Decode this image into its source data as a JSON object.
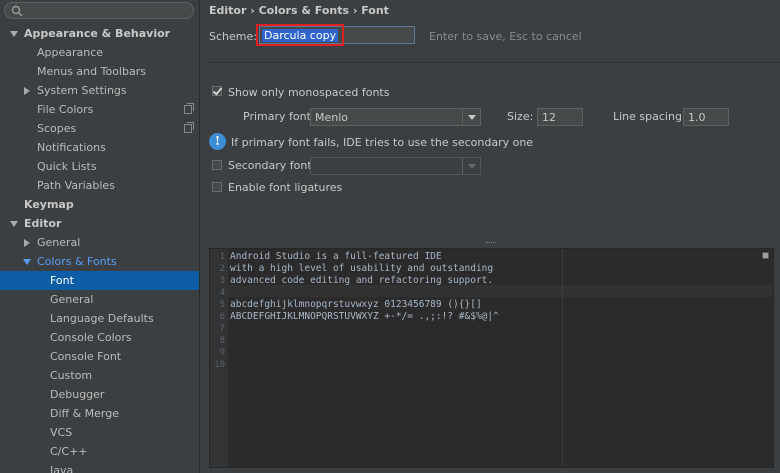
{
  "sidebar": {
    "search_placeholder": "",
    "items": [
      {
        "label": "Appearance & Behavior"
      },
      {
        "label": "Appearance"
      },
      {
        "label": "Menus and Toolbars"
      },
      {
        "label": "System Settings"
      },
      {
        "label": "File Colors"
      },
      {
        "label": "Scopes"
      },
      {
        "label": "Notifications"
      },
      {
        "label": "Quick Lists"
      },
      {
        "label": "Path Variables"
      },
      {
        "label": "Keymap"
      },
      {
        "label": "Editor"
      },
      {
        "label": "General"
      },
      {
        "label": "Colors & Fonts"
      },
      {
        "label": "Font"
      },
      {
        "label": "General"
      },
      {
        "label": "Language Defaults"
      },
      {
        "label": "Console Colors"
      },
      {
        "label": "Console Font"
      },
      {
        "label": "Custom"
      },
      {
        "label": "Debugger"
      },
      {
        "label": "Diff & Merge"
      },
      {
        "label": "VCS"
      },
      {
        "label": "C/C++"
      },
      {
        "label": "Java"
      }
    ]
  },
  "breadcrumb": "Editor › Colors & Fonts › Font",
  "scheme": {
    "label": "Scheme:",
    "value": "Darcula copy",
    "hint": "Enter to save, Esc to cancel"
  },
  "font": {
    "monospaced_label": "Show only monospaced fonts",
    "primary_label": "Primary font:",
    "primary_value": "Menlo",
    "size_label": "Size:",
    "size_value": "12",
    "line_spacing_label": "Line spacing:",
    "line_spacing_value": "1.0",
    "info_text": "If primary font fails, IDE tries to use the secondary one",
    "secondary_label": "Secondary font:",
    "secondary_value": "",
    "ligatures_label": "Enable font ligatures"
  },
  "preview": {
    "line_numbers": [
      "1",
      "2",
      "3",
      "4",
      "5",
      "6",
      "7",
      "8",
      "9",
      "10"
    ],
    "lines": [
      "Android Studio is a full-featured IDE",
      "with a high level of usability and outstanding",
      "advanced code editing and refactoring support.",
      "",
      "abcdefghijklmnopqrstuvwxyz 0123456789 (){}[]",
      "ABCDEFGHIJKLMNOPQRSTUVWXYZ +-*/= .,;:!? #&$%@|^",
      "",
      "",
      "",
      ""
    ]
  },
  "colors": {
    "selected_bg": "#0d5ca6",
    "link_blue": "#589df6",
    "highlight_red": "#e02020"
  }
}
